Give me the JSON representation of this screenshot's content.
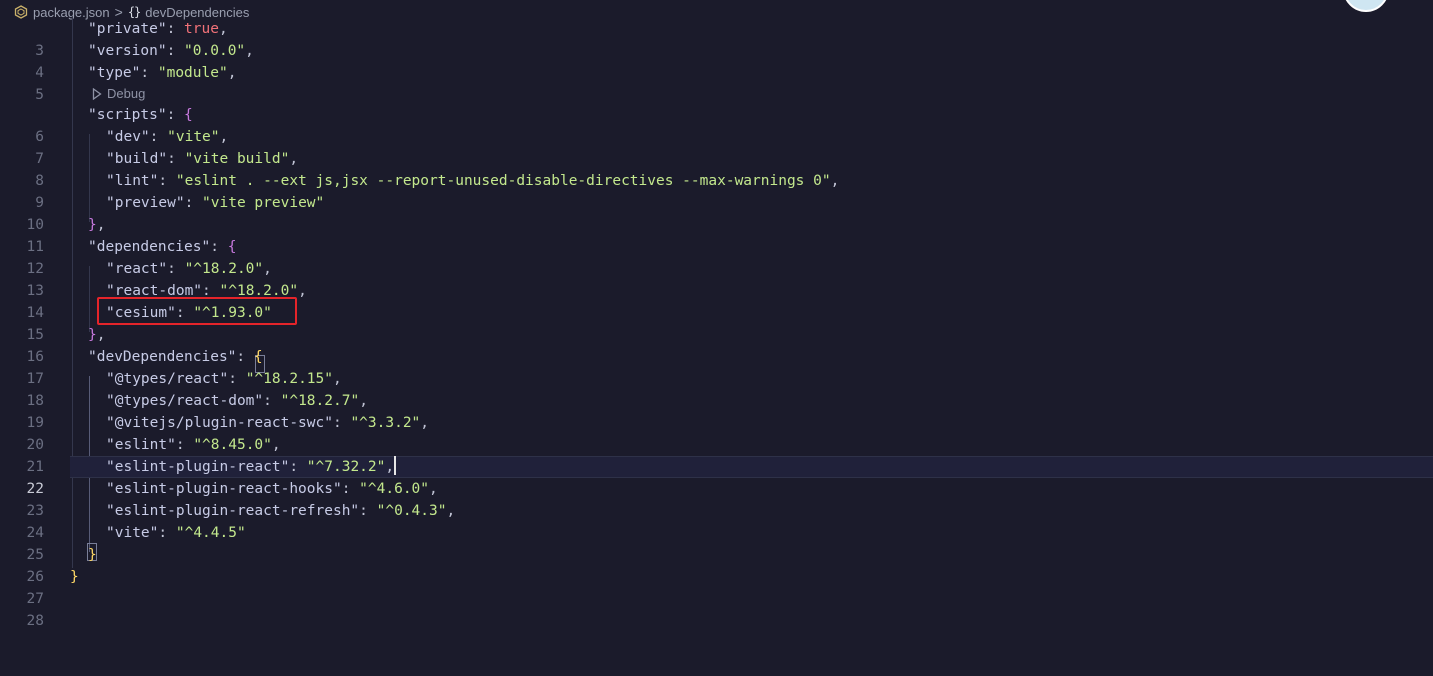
{
  "breadcrumb": {
    "file_icon": "json-file-icon",
    "file": "package.json",
    "separator": ">",
    "symbol_icon": "braces-icon",
    "symbol_glyph": "{}",
    "symbol": "devDependencies"
  },
  "codelens": {
    "icon": "play-icon",
    "label": "Debug"
  },
  "lines": [
    {
      "n": "3"
    },
    {
      "n": "4"
    },
    {
      "n": "5"
    },
    {
      "n": "6"
    },
    {
      "n": "7"
    },
    {
      "n": "8"
    },
    {
      "n": "9"
    },
    {
      "n": "10"
    },
    {
      "n": "11"
    },
    {
      "n": "12"
    },
    {
      "n": "13"
    },
    {
      "n": "14"
    },
    {
      "n": "15"
    },
    {
      "n": "16"
    },
    {
      "n": "17"
    },
    {
      "n": "18"
    },
    {
      "n": "19"
    },
    {
      "n": "20"
    },
    {
      "n": "21"
    },
    {
      "n": "22"
    },
    {
      "n": "23"
    },
    {
      "n": "24"
    },
    {
      "n": "25"
    },
    {
      "n": "26"
    },
    {
      "n": "27"
    },
    {
      "n": "28"
    }
  ],
  "code": {
    "private_key": "\"private\"",
    "private_val": "true",
    "version_key": "\"version\"",
    "version_val": "\"0.0.0\"",
    "type_key": "\"type\"",
    "type_val": "\"module\"",
    "scripts_key": "\"scripts\"",
    "dev_key": "\"dev\"",
    "dev_val": "\"vite\"",
    "build_key": "\"build\"",
    "build_val": "\"vite build\"",
    "lint_key": "\"lint\"",
    "lint_val": "\"eslint . --ext js,jsx --report-unused-disable-directives --max-warnings 0\"",
    "preview_key": "\"preview\"",
    "preview_val": "\"vite preview\"",
    "dependencies_key": "\"dependencies\"",
    "react_key": "\"react\"",
    "react_val": "\"^18.2.0\"",
    "react_dom_key": "\"react-dom\"",
    "react_dom_val": "\"^18.2.0\"",
    "cesium_key": "\"cesium\"",
    "cesium_val": "\"^1.93.0\"",
    "devdeps_key": "\"devDependencies\"",
    "types_react_key": "\"@types/react\"",
    "types_react_val": "\"^18.2.15\"",
    "types_react_dom_key": "\"@types/react-dom\"",
    "types_react_dom_val": "\"^18.2.7\"",
    "vitejs_key": "\"@vitejs/plugin-react-swc\"",
    "vitejs_val": "\"^3.3.2\"",
    "eslint_key": "\"eslint\"",
    "eslint_val": "\"^8.45.0\"",
    "eslint_react_key": "\"eslint-plugin-react\"",
    "eslint_react_val": "\"^7.32.2\"",
    "eslint_hooks_key": "\"eslint-plugin-react-hooks\"",
    "eslint_hooks_val": "\"^4.6.0\"",
    "eslint_refresh_key": "\"eslint-plugin-react-refresh\"",
    "eslint_refresh_val": "\"^0.4.3\"",
    "vite_key": "\"vite\"",
    "vite_val": "\"^4.4.5\""
  },
  "active_line": "22",
  "colors": {
    "background": "#1b1b2b",
    "string": "#c3e88d",
    "key": "#c7cbe6",
    "boolean": "#f07178",
    "highlight_box": "#e5242a"
  }
}
